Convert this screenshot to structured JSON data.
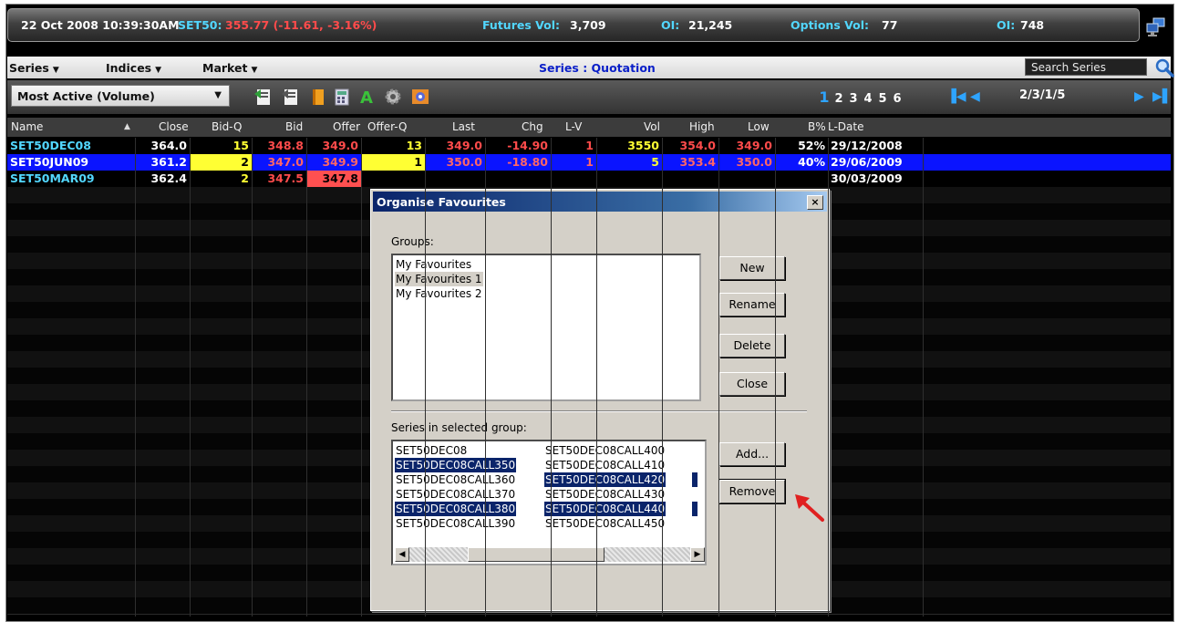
{
  "ticker": {
    "datetime": "22 Oct 2008 10:39:30AM",
    "index_label": "SET50:",
    "index_value": "355.77 (-11.61, -3.16%)",
    "futures_vol_label": "Futures Vol:",
    "futures_vol": "3,709",
    "oi1_label": "OI:",
    "oi1": "21,245",
    "options_vol_label": "Options Vol:",
    "options_vol": "77",
    "oi2_label": "OI:",
    "oi2": "748"
  },
  "menu": {
    "series": "Series",
    "indices": "Indices",
    "market": "Market",
    "title": "Series : Quotation",
    "search_placeholder": "Search Series"
  },
  "toolbar": {
    "view": "Most Active (Volume)",
    "pages": [
      "1",
      "2",
      "3",
      "4",
      "5",
      "6"
    ],
    "page_info": "2/3/1/5"
  },
  "table": {
    "headers": [
      "Name",
      "Close",
      "Bid-Q",
      "Bid",
      "Offer",
      "Offer-Q",
      "Last",
      "Chg",
      "L-V",
      "Vol",
      "High",
      "Low",
      "B%",
      "L-Date"
    ],
    "rows": [
      [
        "SET50DEC08",
        "364.0",
        "15",
        "348.8",
        "349.0",
        "13",
        "349.0",
        "-14.90",
        "1",
        "3550",
        "354.0",
        "349.0",
        "52%",
        "29/12/2008"
      ],
      [
        "SET50JUN09",
        "361.2",
        "2",
        "347.0",
        "349.9",
        "1",
        "350.0",
        "-18.80",
        "1",
        "5",
        "353.4",
        "350.0",
        "40%",
        "29/06/2009"
      ],
      [
        "SET50MAR09",
        "362.4",
        "2",
        "347.5",
        "347.8",
        "",
        "",
        "",
        "",
        "",
        "",
        "",
        "",
        "30/03/2009"
      ]
    ]
  },
  "dialog": {
    "title": "Organise Favourites",
    "close_glyph": "×",
    "groups_label": "Groups:",
    "groups": [
      "My Favourites",
      "My Favourites 1",
      "My Favourites 2"
    ],
    "buttons": {
      "new": "New",
      "rename": "Rename",
      "delete": "Delete",
      "close": "Close",
      "add": "Add...",
      "remove": "Remove"
    },
    "series_label": "Series in selected group:",
    "series_col1": [
      "SET50DEC08",
      "SET50DEC08CALL350",
      "SET50DEC08CALL360",
      "SET50DEC08CALL370",
      "SET50DEC08CALL380",
      "SET50DEC08CALL390"
    ],
    "series_col2": [
      "SET50DEC08CALL400",
      "SET50DEC08CALL410",
      "SET50DEC08CALL420",
      "SET50DEC08CALL430",
      "SET50DEC08CALL440",
      "SET50DEC08CALL450"
    ]
  },
  "colors": {
    "accent": "#0a246a",
    "ticker_label": "#52d7ff",
    "loss": "#ff4b4b",
    "name": "#52d7ff",
    "selected_row": "#0a14ff"
  }
}
